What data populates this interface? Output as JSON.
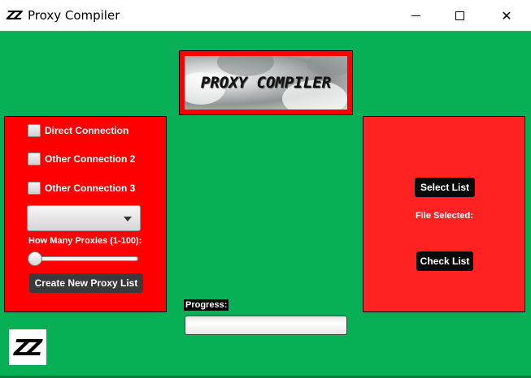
{
  "window": {
    "app_icon_text": "ZZ",
    "title": "Proxy Compiler",
    "minimize_icon": "minimize-icon",
    "maximize_icon": "maximize-icon",
    "close_icon": "close-icon",
    "close_glyph": "✕"
  },
  "colors": {
    "background": "#07b055",
    "panel": "#ff0000",
    "button": "#0a0a0a"
  },
  "banner": {
    "text": "PROXY COMPILER"
  },
  "left_panel": {
    "checkboxes": [
      {
        "label": "Direct Connection",
        "checked": false
      },
      {
        "label": "Other Connection 2",
        "checked": false
      },
      {
        "label": "Other Connection 3",
        "checked": false
      }
    ],
    "dropdown_value": "",
    "slider_label": "How Many Proxies (1-100):",
    "slider_value": 1,
    "create_button": "Create New Proxy List"
  },
  "right_panel": {
    "select_button": "Select List",
    "file_selected_label": "File Selected:",
    "check_button": "Check List"
  },
  "progress": {
    "label": "Progress:",
    "value": 0
  },
  "logo": {
    "text": "ZZ"
  }
}
